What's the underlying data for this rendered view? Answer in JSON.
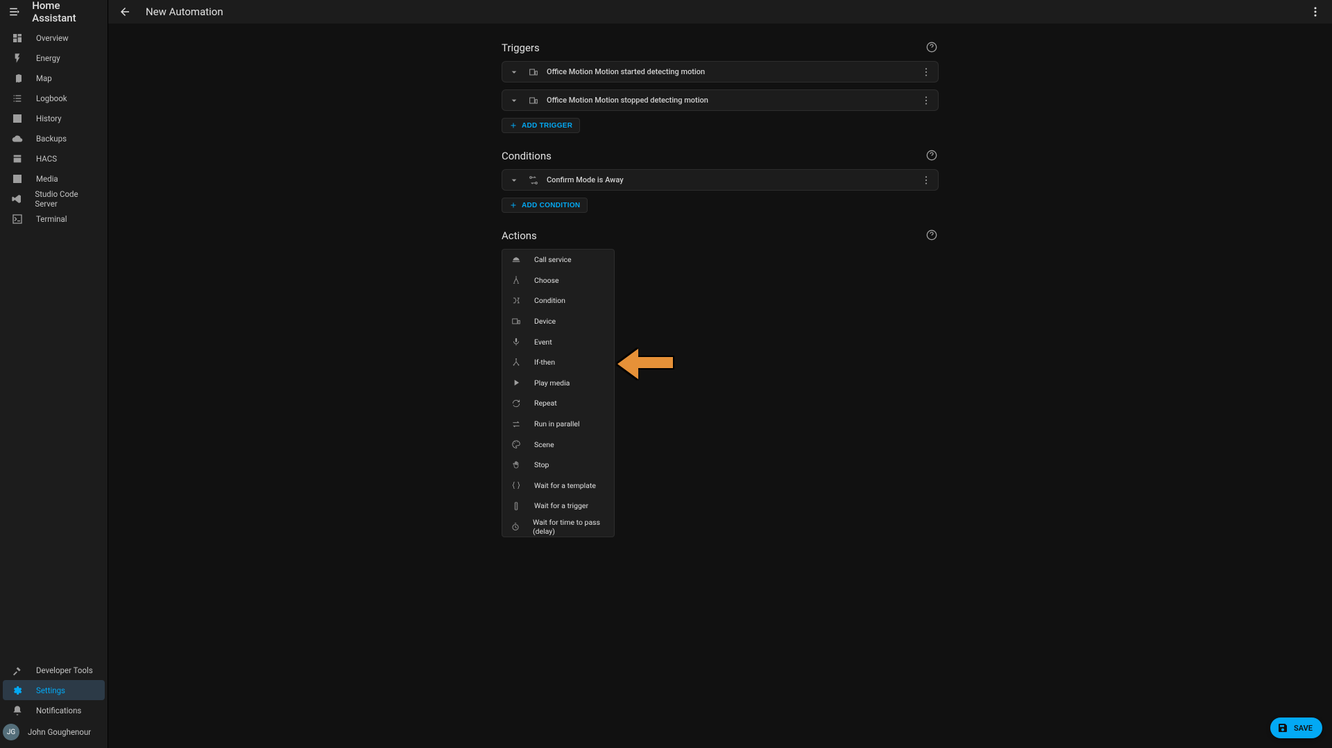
{
  "brand": "Home Assistant",
  "page_title": "New Automation",
  "sidebar": {
    "top": [
      {
        "label": "Overview",
        "icon": "dashboard"
      },
      {
        "label": "Energy",
        "icon": "flash"
      },
      {
        "label": "Map",
        "icon": "map"
      },
      {
        "label": "Logbook",
        "icon": "list"
      },
      {
        "label": "History",
        "icon": "chart"
      },
      {
        "label": "Backups",
        "icon": "cloud"
      },
      {
        "label": "HACS",
        "icon": "store"
      },
      {
        "label": "Media",
        "icon": "play-box"
      },
      {
        "label": "Studio Code Server",
        "icon": "vscode"
      },
      {
        "label": "Terminal",
        "icon": "console"
      }
    ],
    "bottom": [
      {
        "label": "Developer Tools",
        "icon": "hammer",
        "active": false
      },
      {
        "label": "Settings",
        "icon": "cog",
        "active": true
      },
      {
        "label": "Notifications",
        "icon": "bell",
        "active": false
      }
    ],
    "user": {
      "initials": "JG",
      "name": "John Goughenour"
    }
  },
  "sections": {
    "triggers": {
      "title": "Triggers",
      "items": [
        "Office Motion Motion started detecting motion",
        "Office Motion Motion stopped detecting motion"
      ],
      "add_label": "ADD TRIGGER"
    },
    "conditions": {
      "title": "Conditions",
      "items": [
        "Confirm Mode is Away"
      ],
      "add_label": "ADD CONDITION"
    },
    "actions": {
      "title": "Actions",
      "picker": [
        {
          "label": "Call service",
          "icon": "room-service"
        },
        {
          "label": "Choose",
          "icon": "shuffle"
        },
        {
          "label": "Condition",
          "icon": "ab-test"
        },
        {
          "label": "Device",
          "icon": "devices"
        },
        {
          "label": "Event",
          "icon": "mic"
        },
        {
          "label": "If-then",
          "icon": "branch"
        },
        {
          "label": "Play media",
          "icon": "play"
        },
        {
          "label": "Repeat",
          "icon": "refresh"
        },
        {
          "label": "Run in parallel",
          "icon": "swap"
        },
        {
          "label": "Scene",
          "icon": "palette"
        },
        {
          "label": "Stop",
          "icon": "hand"
        },
        {
          "label": "Wait for a template",
          "icon": "braces"
        },
        {
          "label": "Wait for a trigger",
          "icon": "traffic-light"
        },
        {
          "label": "Wait for time to pass (delay)",
          "icon": "timer"
        }
      ]
    }
  },
  "fab_label": "SAVE"
}
